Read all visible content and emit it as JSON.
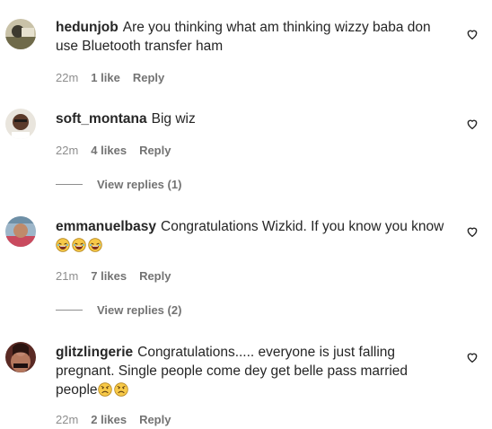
{
  "comments": [
    {
      "username": "hedunjob",
      "text_line1": "Are you thinking what am thinking wizzy baba don",
      "text_line2": "use Bluetooth transfer ham",
      "time": "22m",
      "likes": "1 like",
      "reply": "Reply"
    },
    {
      "username": "soft_montana",
      "text_line1": "Big wiz",
      "time": "22m",
      "likes": "4 likes",
      "reply": "Reply",
      "view_replies": "View replies (1)"
    },
    {
      "username": "emmanuelbasy",
      "text_line1": "Congratulations Wizkid. If you know you know",
      "emojis": [
        "laughing",
        "laughing",
        "laughing"
      ],
      "time": "21m",
      "likes": "7 likes",
      "reply": "Reply",
      "view_replies": "View replies (2)"
    },
    {
      "username": "glitzlingerie",
      "text_line1": "Congratulations..... everyone is just falling",
      "text_line2": "pregnant. Single people come dey get belle pass married",
      "text_line3": "people",
      "emojis": [
        "sad",
        "sad"
      ],
      "time": "22m",
      "likes": "2 likes",
      "reply": "Reply"
    }
  ],
  "colors": {
    "text": "#262626",
    "muted": "#8e8e8e",
    "emoji_face": "#f7c948"
  },
  "icons": [
    "heart-outline-icon",
    "laughing-emoji-icon",
    "sad-emoji-icon"
  ]
}
